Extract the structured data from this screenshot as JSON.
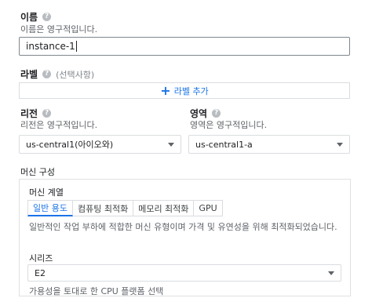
{
  "name": {
    "label": "이름",
    "hint": "이름은 영구적입니다.",
    "value": "instance-1"
  },
  "labels": {
    "label": "라벨",
    "optional": "(선택사항)",
    "add_button": "라벨 추가"
  },
  "region": {
    "label": "리전",
    "hint": "리전은 영구적입니다.",
    "value": "us-central1(아이오와)"
  },
  "zone": {
    "label": "영역",
    "hint": "영역은 영구적입니다.",
    "value": "us-central1-a"
  },
  "machine_config": {
    "title": "머신 구성",
    "family_label": "머신 계열",
    "tabs": [
      "일반 용도",
      "컴퓨팅 최적화",
      "메모리 최적화",
      "GPU"
    ],
    "active_tab": 0,
    "family_desc": "일반적인 작업 부하에 적합한 머신 유형이며 가격 및 유연성을 위해 최적화되었습니다.",
    "series_label": "시리즈",
    "series_value": "E2",
    "series_hint": "가용성을 토대로 한 CPU 플랫폼 선택"
  },
  "icons": {
    "help": "help-icon",
    "plus": "plus-icon",
    "dropdown": "chevron-down-icon"
  },
  "colors": {
    "accent": "#1a73e8",
    "text": "#202124",
    "hint": "#5f6368",
    "border": "#dadce0"
  }
}
